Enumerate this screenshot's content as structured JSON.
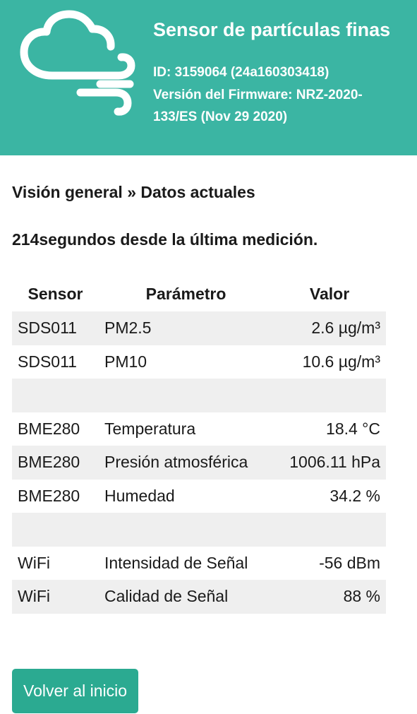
{
  "header": {
    "title": "Sensor de partículas finas",
    "id_line": "ID: 3159064 (24a160303418)",
    "firmware_line": "Versión del Firmware: NRZ-2020-133/ES (Nov 29 2020)",
    "logo_icon": "cloud-wind-icon"
  },
  "breadcrumb": "Visión general » Datos actuales",
  "elapsed_text": "214segundos desde la última medición.",
  "table": {
    "headers": [
      "Sensor",
      "Parámetro",
      "Valor"
    ],
    "rows": [
      {
        "sensor": "SDS011",
        "parameter": "PM2.5",
        "value": "2.6 µg/m³"
      },
      {
        "sensor": "SDS011",
        "parameter": "PM10",
        "value": "10.6 µg/m³"
      },
      {
        "sensor": "",
        "parameter": "",
        "value": ""
      },
      {
        "sensor": "BME280",
        "parameter": "Temperatura",
        "value": "18.4 °C"
      },
      {
        "sensor": "BME280",
        "parameter": "Presión atmosférica",
        "value": "1006.11 hPa"
      },
      {
        "sensor": "BME280",
        "parameter": "Humedad",
        "value": "34.2 %"
      },
      {
        "sensor": "",
        "parameter": "",
        "value": ""
      },
      {
        "sensor": "WiFi",
        "parameter": "Intensidad de Señal",
        "value": "-56 dBm"
      },
      {
        "sensor": "WiFi",
        "parameter": "Calidad de Señal",
        "value": "88 %"
      }
    ]
  },
  "back_button_label": "Volver al inicio",
  "colors": {
    "header_bg": "#3bb5a3",
    "button_bg": "#2baa91",
    "row_stripe": "#efefef"
  }
}
